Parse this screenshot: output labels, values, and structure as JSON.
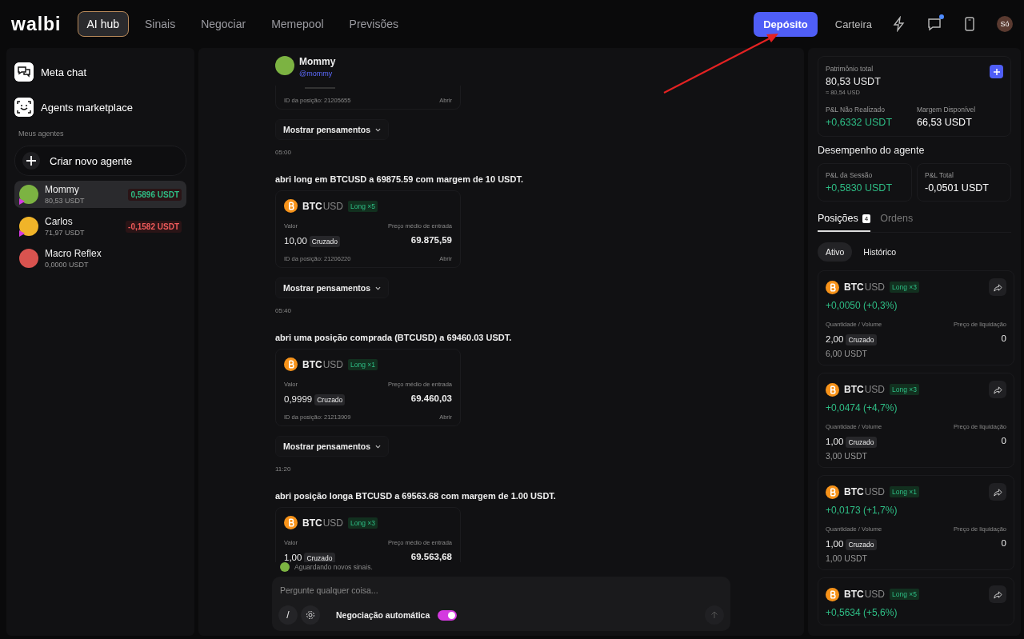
{
  "topbar": {
    "logo": "walbi",
    "nav": [
      {
        "label": "AI hub",
        "selected": true
      },
      {
        "label": "Sinais",
        "selected": false
      },
      {
        "label": "Negociar",
        "selected": false
      },
      {
        "label": "Memepool",
        "selected": false
      },
      {
        "label": "Previsões",
        "selected": false
      }
    ],
    "deposit": "Depósito",
    "wallet": "Carteira",
    "notification": true,
    "profile": "Só"
  },
  "sidebar": {
    "links": [
      {
        "kind": "chat",
        "label": "Meta chat"
      },
      {
        "kind": "market",
        "label": "Agents marketplace"
      }
    ],
    "section": "Meus agentes",
    "create": "Criar novo agente",
    "agents": [
      {
        "name": "Mommy",
        "balance": "80,53 USDT",
        "pnl": "0,5896 USDT",
        "color": "#2ebd85",
        "running": true,
        "selected": true
      },
      {
        "name": "Carlos",
        "balance": "71,97 USDT",
        "pnl": "-0,1582 USDT",
        "color": "#f05a5a",
        "running": true,
        "selected": false
      },
      {
        "name": "Macro Reflex",
        "balance": "0,0000 USDT",
        "running": false,
        "selected": false
      }
    ]
  },
  "chat": {
    "agent": {
      "name": "Mommy",
      "handle": "@mommy"
    },
    "entries": [
      {
        "kind": "card_tail",
        "position_id": "ID da posição: 21205655",
        "action": "Abrir"
      },
      {
        "kind": "thoughts",
        "label": "Mostrar pensamentos"
      },
      {
        "kind": "time",
        "text": "05:00"
      },
      {
        "kind": "message",
        "text": "abri long em BTCUSD a 69875.59 com margem de 10 USDT."
      },
      {
        "kind": "card",
        "base": "BTC",
        "quote": "USD",
        "badge": "Long ×5",
        "value_label": "Valor",
        "value": "10,00",
        "mode": "Cruzado",
        "price_label": "Preço médio de entrada",
        "price": "69.875,59",
        "position_id": "ID da posição: 21206220",
        "action": "Abrir"
      },
      {
        "kind": "thoughts",
        "label": "Mostrar pensamentos"
      },
      {
        "kind": "time",
        "text": "05:40"
      },
      {
        "kind": "message",
        "text": "abri uma posição comprada (BTCUSD) a 69460.03 USDT."
      },
      {
        "kind": "card",
        "base": "BTC",
        "quote": "USD",
        "badge": "Long ×1",
        "value_label": "Valor",
        "value": "0,9999",
        "mode": "Cruzado",
        "price_label": "Preço médio de entrada",
        "price": "69.460,03",
        "position_id": "ID da posição: 21213909",
        "action": "Abrir"
      },
      {
        "kind": "thoughts",
        "label": "Mostrar pensamentos"
      },
      {
        "kind": "time",
        "text": "11:20"
      },
      {
        "kind": "message",
        "text": "abri posição longa BTCUSD a 69563.68 com margem de 1.00 USDT."
      },
      {
        "kind": "card",
        "base": "BTC",
        "quote": "USD",
        "badge": "Long ×3",
        "value_label": "Valor",
        "value": "1,00",
        "mode": "Cruzado",
        "price_label": "Preço médio de entrada",
        "price": "69.563,68"
      }
    ],
    "status": "Aguardando novos sinais.",
    "composer": {
      "placeholder": "Pergunte qualquer coisa...",
      "slash": "/",
      "auto_trading": {
        "label": "Negociação automática",
        "on": true
      }
    }
  },
  "account": {
    "equity_label": "Patrimônio total",
    "equity": "80,53 USDT",
    "equity_usd": "≈ 80,54 USD",
    "stats": [
      {
        "label": "P&L Não Realizado",
        "value": "+0,6332 USDT",
        "color": "#2ebd85"
      },
      {
        "label": "Margem Disponível",
        "value": "66,53 USDT",
        "color": "#ffffff"
      }
    ]
  },
  "performance": {
    "title": "Desempenho do agente",
    "stats": [
      {
        "label": "P&L da Sessão",
        "value": "+0,5830 USDT",
        "color": "#2ebd85"
      },
      {
        "label": "P&L Total",
        "value": "-0,0501 USDT",
        "color": "#ffffff"
      }
    ]
  },
  "tabs": [
    {
      "label": "Posições",
      "count": "4",
      "selected": true
    },
    {
      "label": "Ordens",
      "selected": false
    }
  ],
  "filters": [
    {
      "label": "Ativo",
      "selected": true
    },
    {
      "label": "Histórico",
      "selected": false
    }
  ],
  "positions": [
    {
      "base": "BTC",
      "quote": "USD",
      "badge": "Long ×3",
      "pnl": "+0,0050 (+0,3%)",
      "qty_label": "Quantidade / Volume",
      "qty": "2,00",
      "mode": "Cruzado",
      "liq_label": "Preço de liquidação",
      "liq": "0",
      "volume": "6,00 USDT"
    },
    {
      "base": "BTC",
      "quote": "USD",
      "badge": "Long ×3",
      "pnl": "+0,0474 (+4,7%)",
      "qty_label": "Quantidade / Volume",
      "qty": "1,00",
      "mode": "Cruzado",
      "liq_label": "Preço de liquidação",
      "liq": "0",
      "volume": "3,00 USDT"
    },
    {
      "base": "BTC",
      "quote": "USD",
      "badge": "Long ×1",
      "pnl": "+0,0173 (+1,7%)",
      "qty_label": "Quantidade / Volume",
      "qty": "1,00",
      "mode": "Cruzado",
      "liq_label": "Preço de liquidação",
      "liq": "0",
      "volume": "1,00 USDT"
    },
    {
      "base": "BTC",
      "quote": "USD",
      "badge": "Long ×5",
      "pnl": "+0,5634 (+5,6%)"
    }
  ]
}
